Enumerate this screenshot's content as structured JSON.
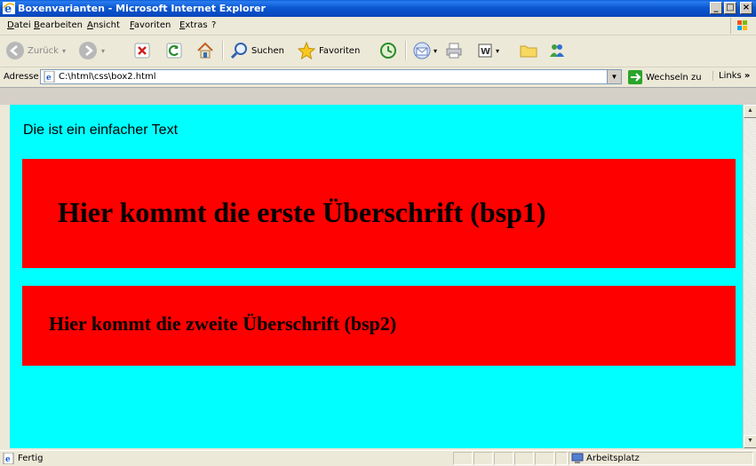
{
  "window": {
    "title": "Boxenvarianten - Microsoft Internet Explorer",
    "buttons": [
      "_",
      "□",
      "×"
    ]
  },
  "menu": [
    "Datei",
    "Bearbeiten",
    "Ansicht",
    "Favoriten",
    "Extras",
    "?"
  ],
  "toolbar": {
    "back": "Zurück",
    "search": "Suchen",
    "favorites": "Favoriten"
  },
  "address": {
    "label": "Adresse",
    "url": "C:\\html\\css\\box2.html",
    "go_label": "Wechseln zu",
    "links_label": "Links"
  },
  "page": {
    "intro_text": "Die ist ein einfacher Text",
    "heading1": "Hier kommt die erste Überschrift (bsp1)",
    "heading2": "Hier kommt die zweite Überschrift (bsp2)",
    "background_color": "#00ffff",
    "box_color": "#ff0000"
  },
  "status": {
    "left": "Fertig",
    "zone": "Arbeitsplatz"
  }
}
